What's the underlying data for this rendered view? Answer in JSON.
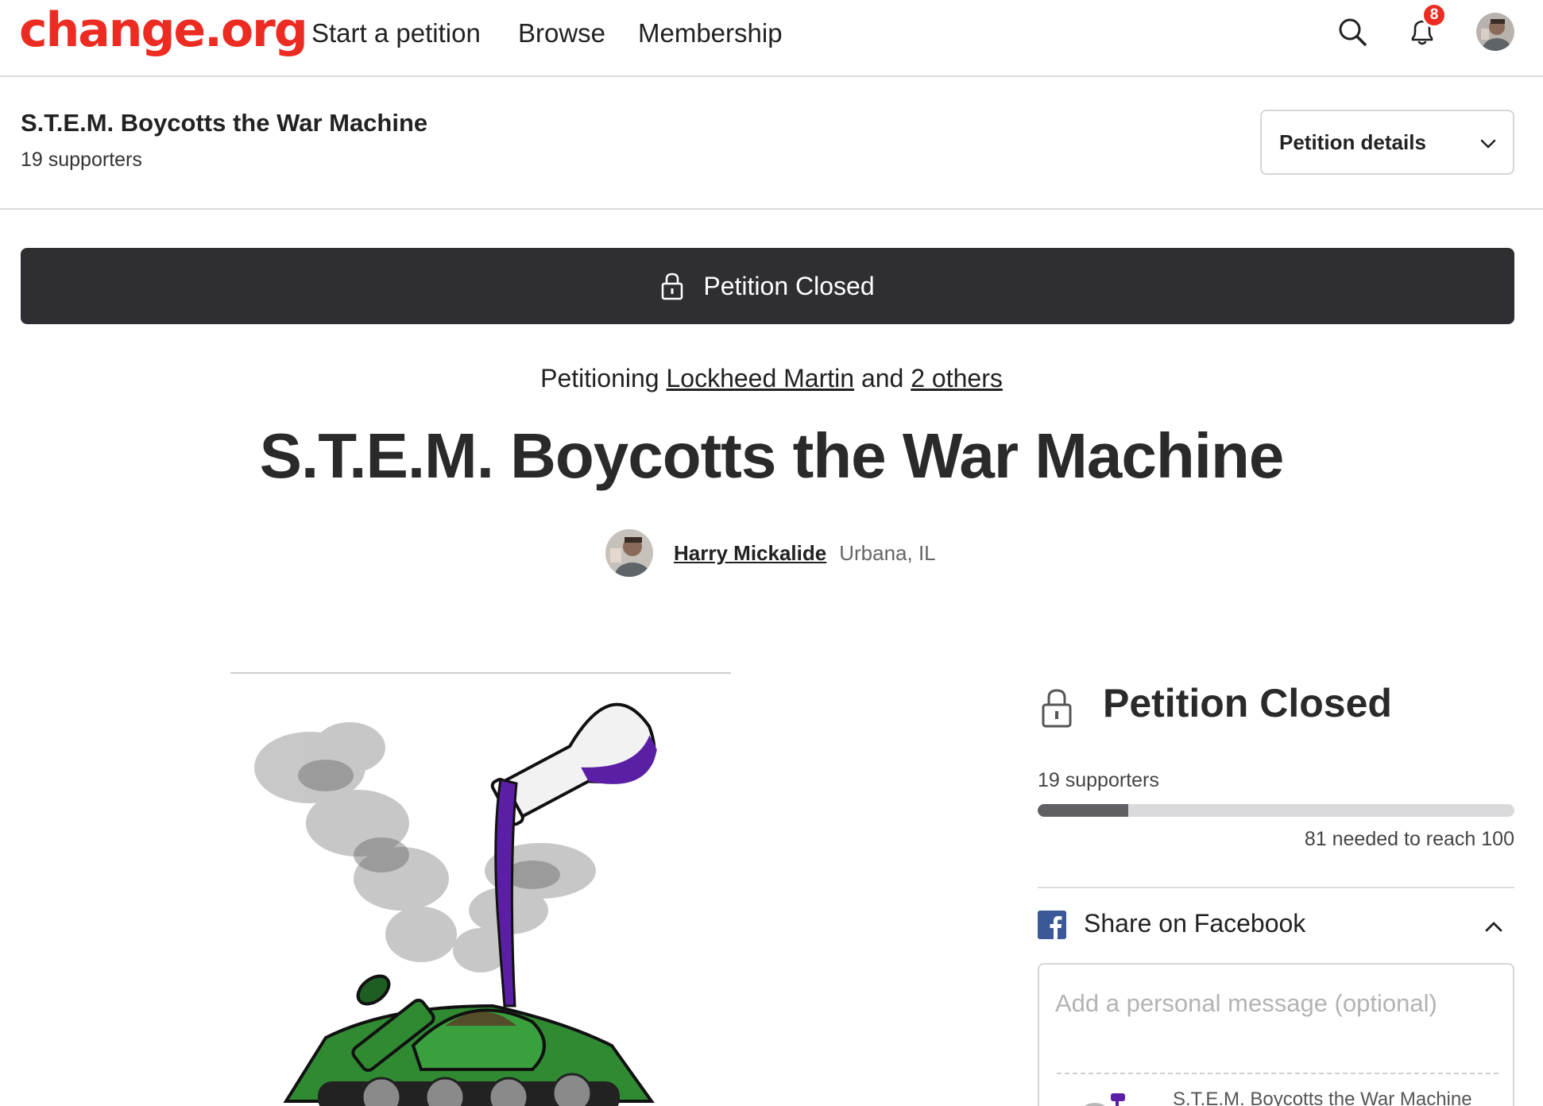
{
  "nav": {
    "logo": "change.org",
    "links": [
      "Start a petition",
      "Browse",
      "Membership"
    ],
    "notification_count": "8",
    "icons": [
      "search-icon",
      "bell-icon",
      "user-avatar"
    ],
    "brand_color": "#ec2c22"
  },
  "subheader": {
    "title": "S.T.E.M. Boycotts the War Machine",
    "supporters": "19 supporters",
    "details_button": "Petition details"
  },
  "banner": {
    "text": "Petition Closed",
    "background": "#2f2e33"
  },
  "petition": {
    "petitioning_prefix": "Petitioning",
    "target": "Lockheed Martin",
    "and_text": "and",
    "others": "2 others",
    "title": "S.T.E.M. Boycotts the War Machine",
    "author": "Harry Mickalide",
    "location": "Urbana, IL"
  },
  "sidebar": {
    "status_title": "Petition Closed",
    "supporters": "19 supporters",
    "progress_fraction": 0.19,
    "needed": "81 needed to reach 100",
    "share_label": "Share on Facebook",
    "message_placeholder": "Add a personal message (optional)",
    "preview_title": "S.T.E.M. Boycotts the War Machine"
  }
}
